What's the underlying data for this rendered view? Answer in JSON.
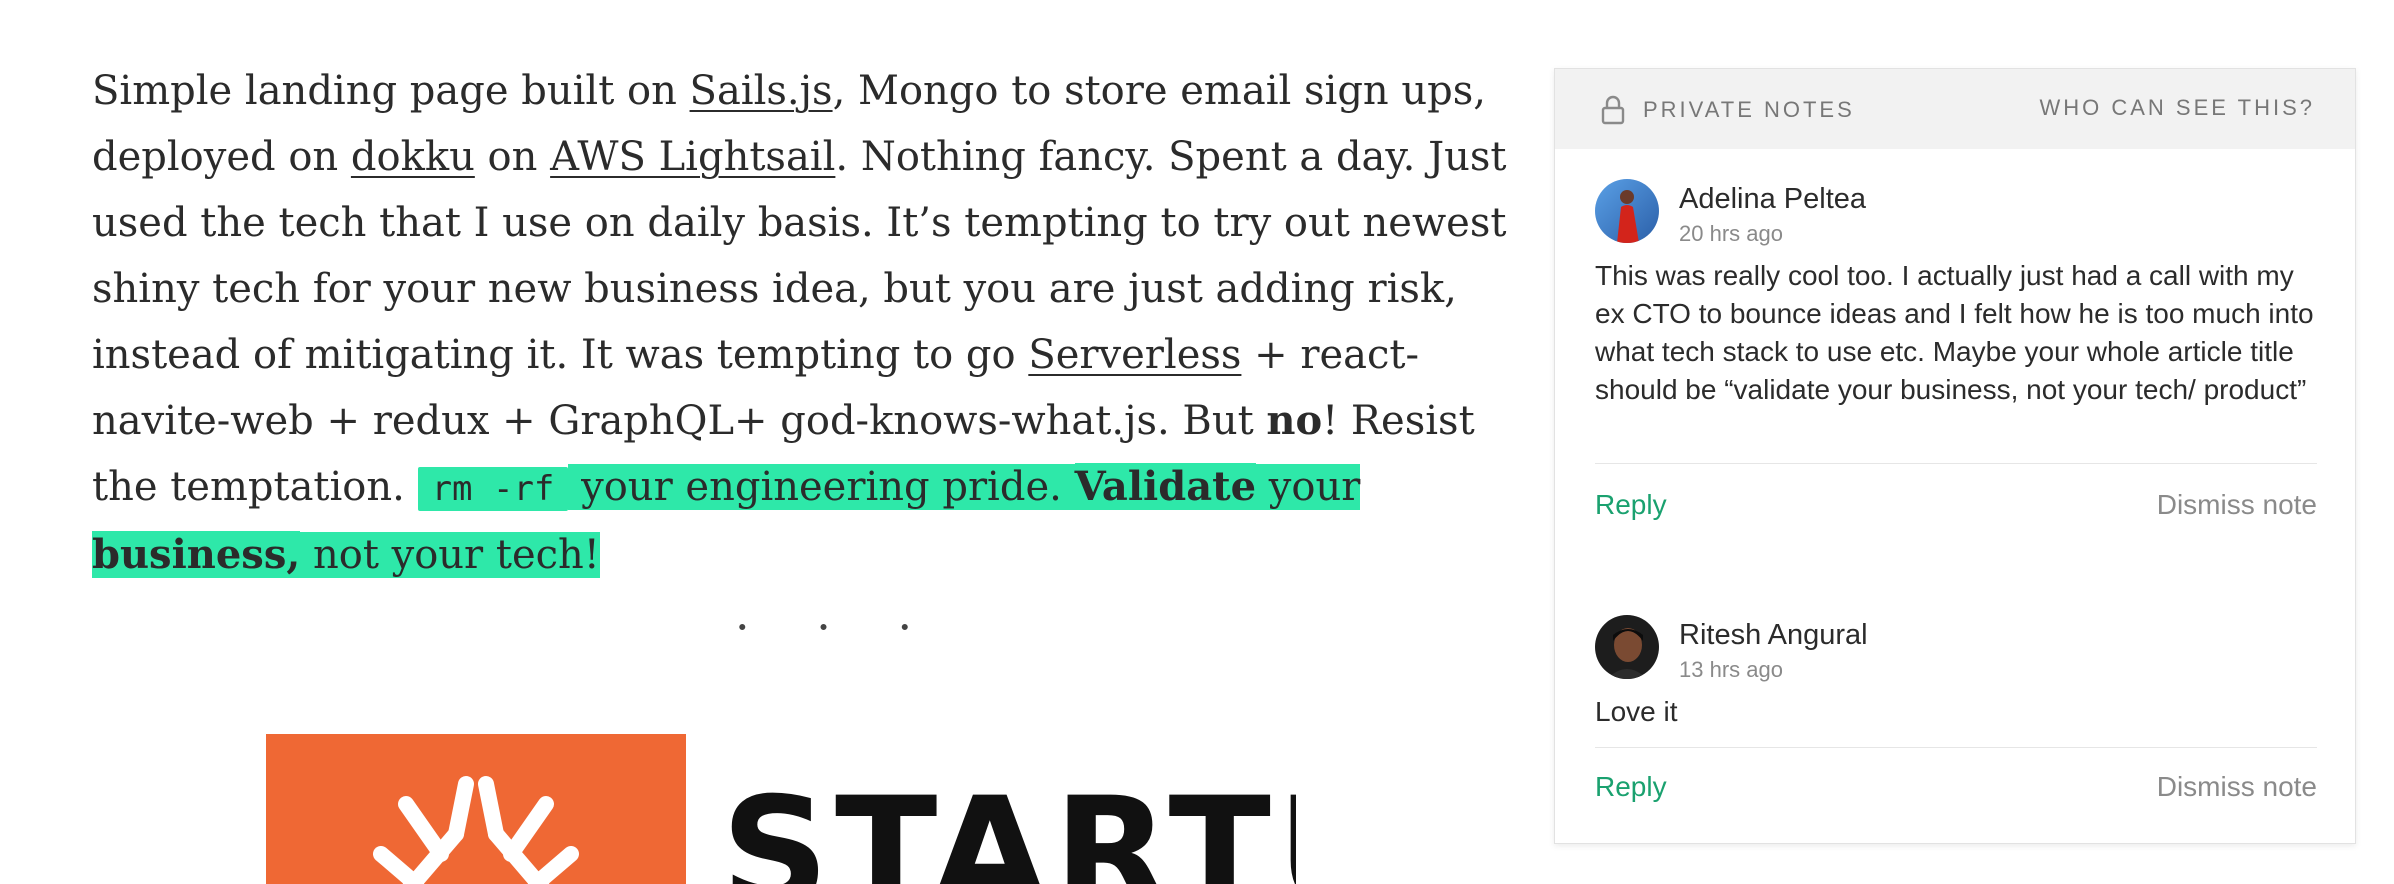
{
  "article": {
    "seg1": "Simple landing page built on ",
    "link_sails": "Sails.js",
    "seg2": ", Mongo to store email sign ups, deployed on ",
    "link_dokku": "dokku",
    "seg3": " on ",
    "link_lightsail": "AWS Lightsail",
    "seg4": ". Nothing fancy. Spent a day. Just used the tech that I use on daily basis. It’s tempting to try out newest shiny tech for your new business idea, but you are just adding risk, instead of mitigating it. It was tempting to go ",
    "link_serverless": "Serverless",
    "seg5": " + react-navite-web + redux + GraphQL+ god-knows-what.js. But ",
    "bold_no": "no",
    "seg6": "! Resist the temptation. ",
    "code": "rm -rf",
    "hl_seg1": " your engineering pride. ",
    "hl_bold_validate": "Validate",
    "hl_seg2": " your ",
    "hl_bold_business": "business,",
    "hl_seg3": " not your tech!"
  },
  "separator": "· · ·",
  "logo": {
    "word": "STARTUP",
    "color": "#ef6834"
  },
  "notes": {
    "title": "PRIVATE NOTES",
    "who_link": "WHO CAN SEE THIS?",
    "icon": "lock-icon",
    "accent": "#1aa16f",
    "items": [
      {
        "author": "Adelina Peltea",
        "time": "20 hrs ago",
        "body": "This was really cool too. I actually just had a call with my ex CTO to bounce ideas and I felt how he is too much into what tech stack to use etc. Maybe your whole article title should be “validate your business, not your tech/ product”",
        "reply": "Reply",
        "dismiss": "Dismiss note"
      },
      {
        "author": "Ritesh Angural",
        "time": "13 hrs ago",
        "body": "Love it",
        "reply": "Reply",
        "dismiss": "Dismiss note"
      }
    ]
  }
}
